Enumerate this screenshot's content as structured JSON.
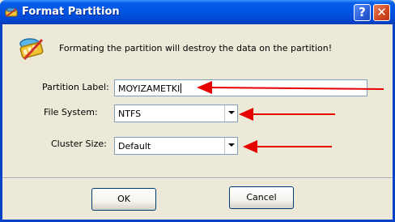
{
  "window": {
    "title": "Format Partition",
    "help_glyph": "?",
    "close_glyph": "✕"
  },
  "message": "Formating the partition will destroy the data on the partition!",
  "form": {
    "partition_label": {
      "label": "Partition Label:",
      "value": "MOYIZAMETKI"
    },
    "file_system": {
      "label": "File System:",
      "value": "NTFS"
    },
    "cluster_size": {
      "label": "Cluster Size:",
      "value": "Default"
    }
  },
  "buttons": {
    "ok": "OK",
    "cancel": "Cancel"
  },
  "colors": {
    "title_bar": "#0054e3",
    "dialog_bg": "#ece9d8",
    "annotation_arrow": "#e60000"
  },
  "icons": [
    "app-icon",
    "format-disk-icon",
    "help-icon",
    "close-icon",
    "chevron-down-icon"
  ]
}
